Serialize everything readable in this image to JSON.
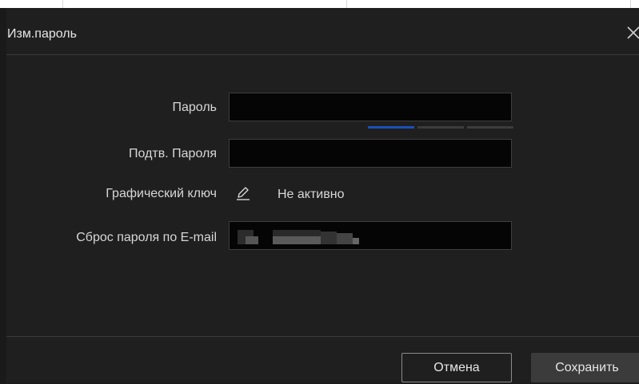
{
  "dialog": {
    "title": "Изм.пароль",
    "close_icon": "close-icon"
  },
  "form": {
    "password": {
      "label": "Пароль",
      "value": "",
      "strength_segments": 3,
      "strength_level": 1,
      "strength_color": "#1c4fb8"
    },
    "confirm": {
      "label": "Подтв. Пароля",
      "value": ""
    },
    "pattern": {
      "label": "Графический ключ",
      "icon": "edit-pencil-icon",
      "status": "Не активно"
    },
    "email_reset": {
      "label": "Сброс пароля по E-mail"
    }
  },
  "footer": {
    "cancel_label": "Отмена",
    "save_label": "Сохранить"
  }
}
